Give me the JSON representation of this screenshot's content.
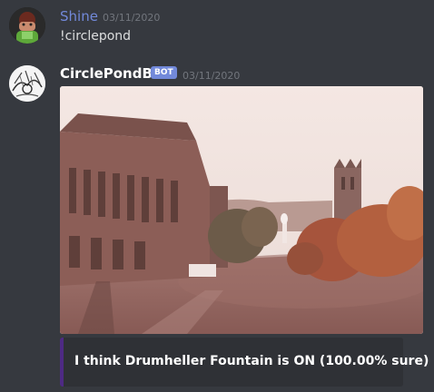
{
  "messages": [
    {
      "username": "Shine",
      "timestamp": "03/11/2020",
      "text": "!circlepond",
      "username_color": "#7289da"
    },
    {
      "username": "CirclePondBot",
      "badge": "BOT",
      "timestamp": "03/11/2020",
      "username_color": "#ffffff",
      "embed": {
        "title": "I think Drumheller Fountain is ON (100.00% sure)",
        "accent_color": "#4e2a84"
      }
    }
  ],
  "colors": {
    "background": "#36393f",
    "embed_background": "#2f3136",
    "bot_badge": "#7289da"
  },
  "icons": {
    "user_avatar": "green-character-avatar",
    "bot_avatar": "ink-sketch-avatar"
  }
}
